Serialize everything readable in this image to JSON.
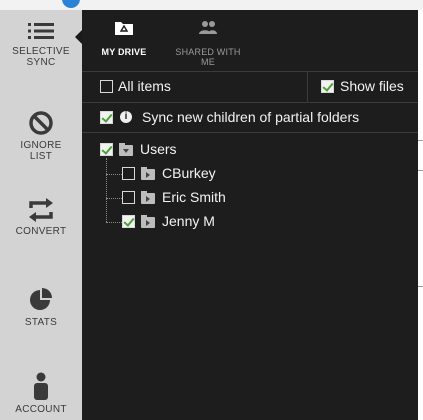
{
  "sidebar": {
    "items": [
      {
        "label_line1": "SELECTIVE",
        "label_line2": "SYNC",
        "icon": "list-icon"
      },
      {
        "label_line1": "IGNORE",
        "label_line2": "LIST",
        "icon": "block-icon"
      },
      {
        "label_line1": "CONVERT",
        "label_line2": "",
        "icon": "convert-icon"
      },
      {
        "label_line1": "STATS",
        "label_line2": "",
        "icon": "pie-chart-icon"
      },
      {
        "label_line1": "ACCOUNT",
        "label_line2": "",
        "icon": "person-icon"
      }
    ]
  },
  "tabs": [
    {
      "label_line1": "MY DRIVE",
      "label_line2": "",
      "icon": "drive-folder-icon",
      "active": true
    },
    {
      "label_line1": "SHARED WITH",
      "label_line2": "ME",
      "icon": "people-icon",
      "active": false
    }
  ],
  "options": {
    "all_items": {
      "label": "All items",
      "checked": false
    },
    "show_files": {
      "label": "Show files",
      "checked": true
    },
    "sync_children": {
      "label": "Sync new children of partial folders",
      "checked": true
    }
  },
  "tree": {
    "root": {
      "label": "Users",
      "checked": true
    },
    "children": [
      {
        "label": "CBurkey",
        "checked": false
      },
      {
        "label": "Eric Smith",
        "checked": false
      },
      {
        "label": "Jenny M",
        "checked": true
      }
    ]
  },
  "colors": {
    "panel_bg": "#1d1d1d",
    "sidebar_bg": "#d3d3d3",
    "check_green": "#4aa336"
  }
}
